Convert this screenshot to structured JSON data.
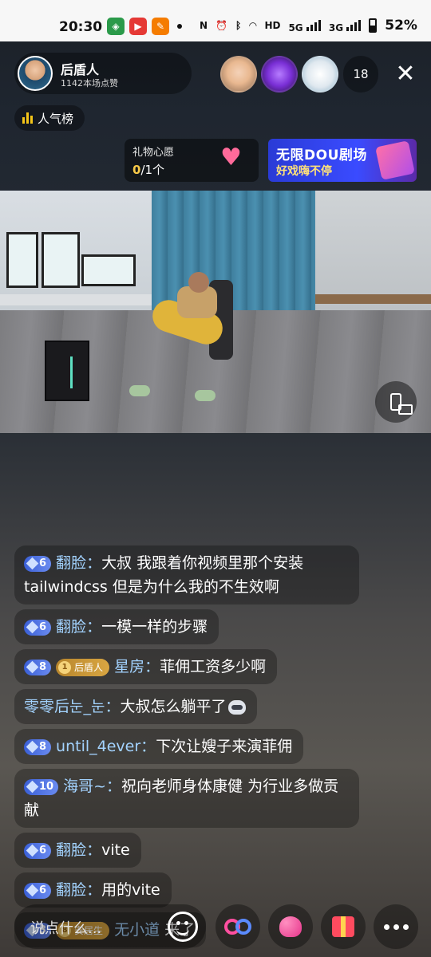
{
  "status_bar": {
    "time": "20:30",
    "battery_pct": "52%",
    "network": [
      "5G",
      "3G"
    ],
    "icons": [
      "app-icon-1",
      "app-icon-2",
      "app-icon-3",
      "nfc-icon",
      "alarm-icon",
      "bluetooth-icon",
      "wifi-icon",
      "hd-icon",
      "signal-icon",
      "battery-icon"
    ]
  },
  "anchor": {
    "name": "后盾人",
    "likes": "1142本场点赞"
  },
  "viewers": {
    "count": "18",
    "avatars": [
      "viewer-avatar-baby",
      "viewer-avatar-fish",
      "viewer-avatar-cartoon"
    ]
  },
  "rank": {
    "label": "人气榜"
  },
  "gift_wish": {
    "title": "礼物心愿",
    "progress_current": "0",
    "progress_total": "/1个"
  },
  "banner": {
    "title": "无限DOU剧场",
    "subtitle": "好戏嗨不停"
  },
  "comments": [
    {
      "level": "6",
      "user": "翻脸",
      "text": "大叔  我跟着你视频里那个安装tailwindcss  但是为什么我的不生效啊"
    },
    {
      "level": "6",
      "user": "翻脸",
      "text": "一模一样的步骤"
    },
    {
      "level": "8",
      "fan_badge": "后盾人",
      "fan_level": "1",
      "user": "星房",
      "text": "菲佣工资多少啊"
    },
    {
      "user": "零零后눈_눈",
      "text": "大叔怎么躺平了"
    },
    {
      "level": "8",
      "user": "until_4ever",
      "text": "下次让嫂子来演菲佣"
    },
    {
      "level": "10",
      "user": "海哥~",
      "text": "祝向老师身体康健 为行业多做贡献"
    },
    {
      "level": "6",
      "user": "翻脸",
      "text": "vite"
    },
    {
      "level": "6",
      "user": "翻脸",
      "text": "用的vite"
    },
    {
      "level": "3",
      "fan_badge": "安居生",
      "fan_level": "8",
      "user": "无小道",
      "text": "来了"
    }
  ],
  "bottom_bar": {
    "input_placeholder": "说点什么...",
    "buttons": [
      "emoji-icon",
      "link-icon",
      "heart-icon",
      "gift-icon",
      "more-icon"
    ]
  },
  "colors": {
    "username": "#a3d3ff",
    "level_badge": "#3a5fd6",
    "fan_badge": "#b8862c",
    "gift_progress": "#f7c948",
    "banner_bg": "#3a4bff"
  }
}
